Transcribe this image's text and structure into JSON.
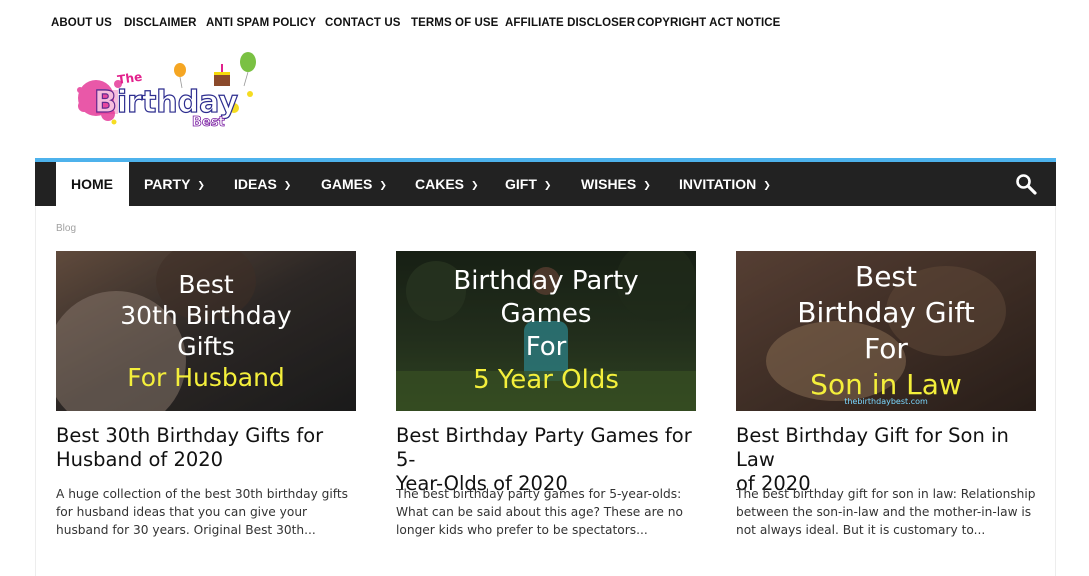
{
  "top_menu": [
    "ABOUT US",
    "DISCLAIMER",
    "ANTI SPAM POLICY",
    "CONTACT US",
    "TERMS OF USE",
    "AFFILIATE DISCLOSER",
    "COPYRIGHT ACT NOTICE"
  ],
  "logo": {
    "line1": "The",
    "line2": "Birthday",
    "line3": "Best"
  },
  "nav": {
    "items": [
      {
        "label": "HOME",
        "active": true
      },
      {
        "label": "PARTY",
        "dropdown": true
      },
      {
        "label": "IDEAS",
        "dropdown": true
      },
      {
        "label": "GAMES",
        "dropdown": true
      },
      {
        "label": "CAKES",
        "dropdown": true
      },
      {
        "label": "GIFT",
        "dropdown": true
      },
      {
        "label": "WISHES",
        "dropdown": true
      },
      {
        "label": "INVITATION",
        "dropdown": true
      }
    ],
    "search_icon": "search-icon",
    "accent_color": "#4db2ec"
  },
  "breadcrumb": "Blog",
  "cards": [
    {
      "image_text": [
        "Best",
        "30th Birthday",
        "Gifts"
      ],
      "image_highlight": "For Husband",
      "title": "Best 30th Birthday Gifts for Husband of 2020",
      "title_lines": [
        "Best 30th Birthday Gifts for",
        "Husband of 2020"
      ],
      "excerpt_lines": [
        "A huge collection of the best 30th birthday gifts",
        "for husband ideas that you can give your",
        "husband for 30 years. Original Best 30th..."
      ]
    },
    {
      "image_text": [
        "Birthday Party",
        "Games",
        "For"
      ],
      "image_highlight": "5 Year Olds",
      "title": "Best Birthday Party Games for 5-Year-Olds of 2020",
      "title_lines": [
        "Best Birthday Party Games for 5-",
        "Year-Olds of 2020"
      ],
      "excerpt_lines": [
        "The best birthday party games for 5-year-olds:",
        "What can be said about this age? These are no",
        "longer kids who prefer to be spectators..."
      ]
    },
    {
      "image_text": [
        "Best",
        "Birthday Gift",
        "For"
      ],
      "image_highlight": "Son in Law",
      "image_watermark": "thebirthdaybest.com",
      "title": "Best Birthday Gift for Son in Law of 2020",
      "title_lines": [
        "Best Birthday Gift for Son in Law",
        "of 2020"
      ],
      "excerpt_lines": [
        "The best birthday gift for son in law: Relationship",
        "between the son-in-law and the mother-in-law is",
        "not always ideal. But it is customary to..."
      ]
    }
  ]
}
